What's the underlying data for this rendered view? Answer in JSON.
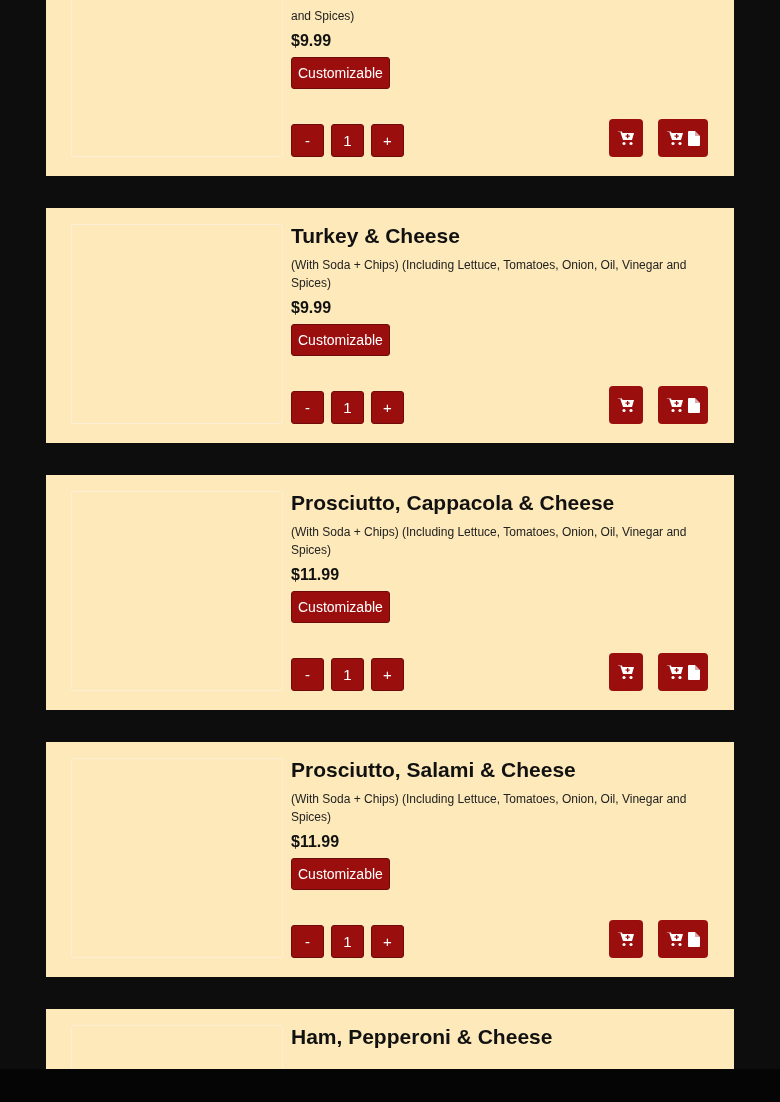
{
  "items": [
    {
      "description": "and Spices)",
      "price": "$9.99",
      "badge": "Customizable",
      "minus": "-",
      "quantity": "1",
      "plus": "+"
    },
    {
      "title": "Turkey & Cheese",
      "description": "(With Soda + Chips) (Including Lettuce, Tomatoes, Onion, Oil, Vinegar and Spices)",
      "price": "$9.99",
      "badge": "Customizable",
      "minus": "-",
      "quantity": "1",
      "plus": "+"
    },
    {
      "title": "Prosciutto, Cappacola & Cheese",
      "description": "(With Soda + Chips) (Including Lettuce, Tomatoes, Onion, Oil, Vinegar and Spices)",
      "price": "$11.99",
      "badge": "Customizable",
      "minus": "-",
      "quantity": "1",
      "plus": "+"
    },
    {
      "title": "Prosciutto, Salami & Cheese",
      "description": "(With Soda + Chips) (Including Lettuce, Tomatoes, Onion, Oil, Vinegar and Spices)",
      "price": "$11.99",
      "badge": "Customizable",
      "minus": "-",
      "quantity": "1",
      "plus": "+"
    },
    {
      "title": "Ham, Pepperoni & Cheese"
    }
  ]
}
